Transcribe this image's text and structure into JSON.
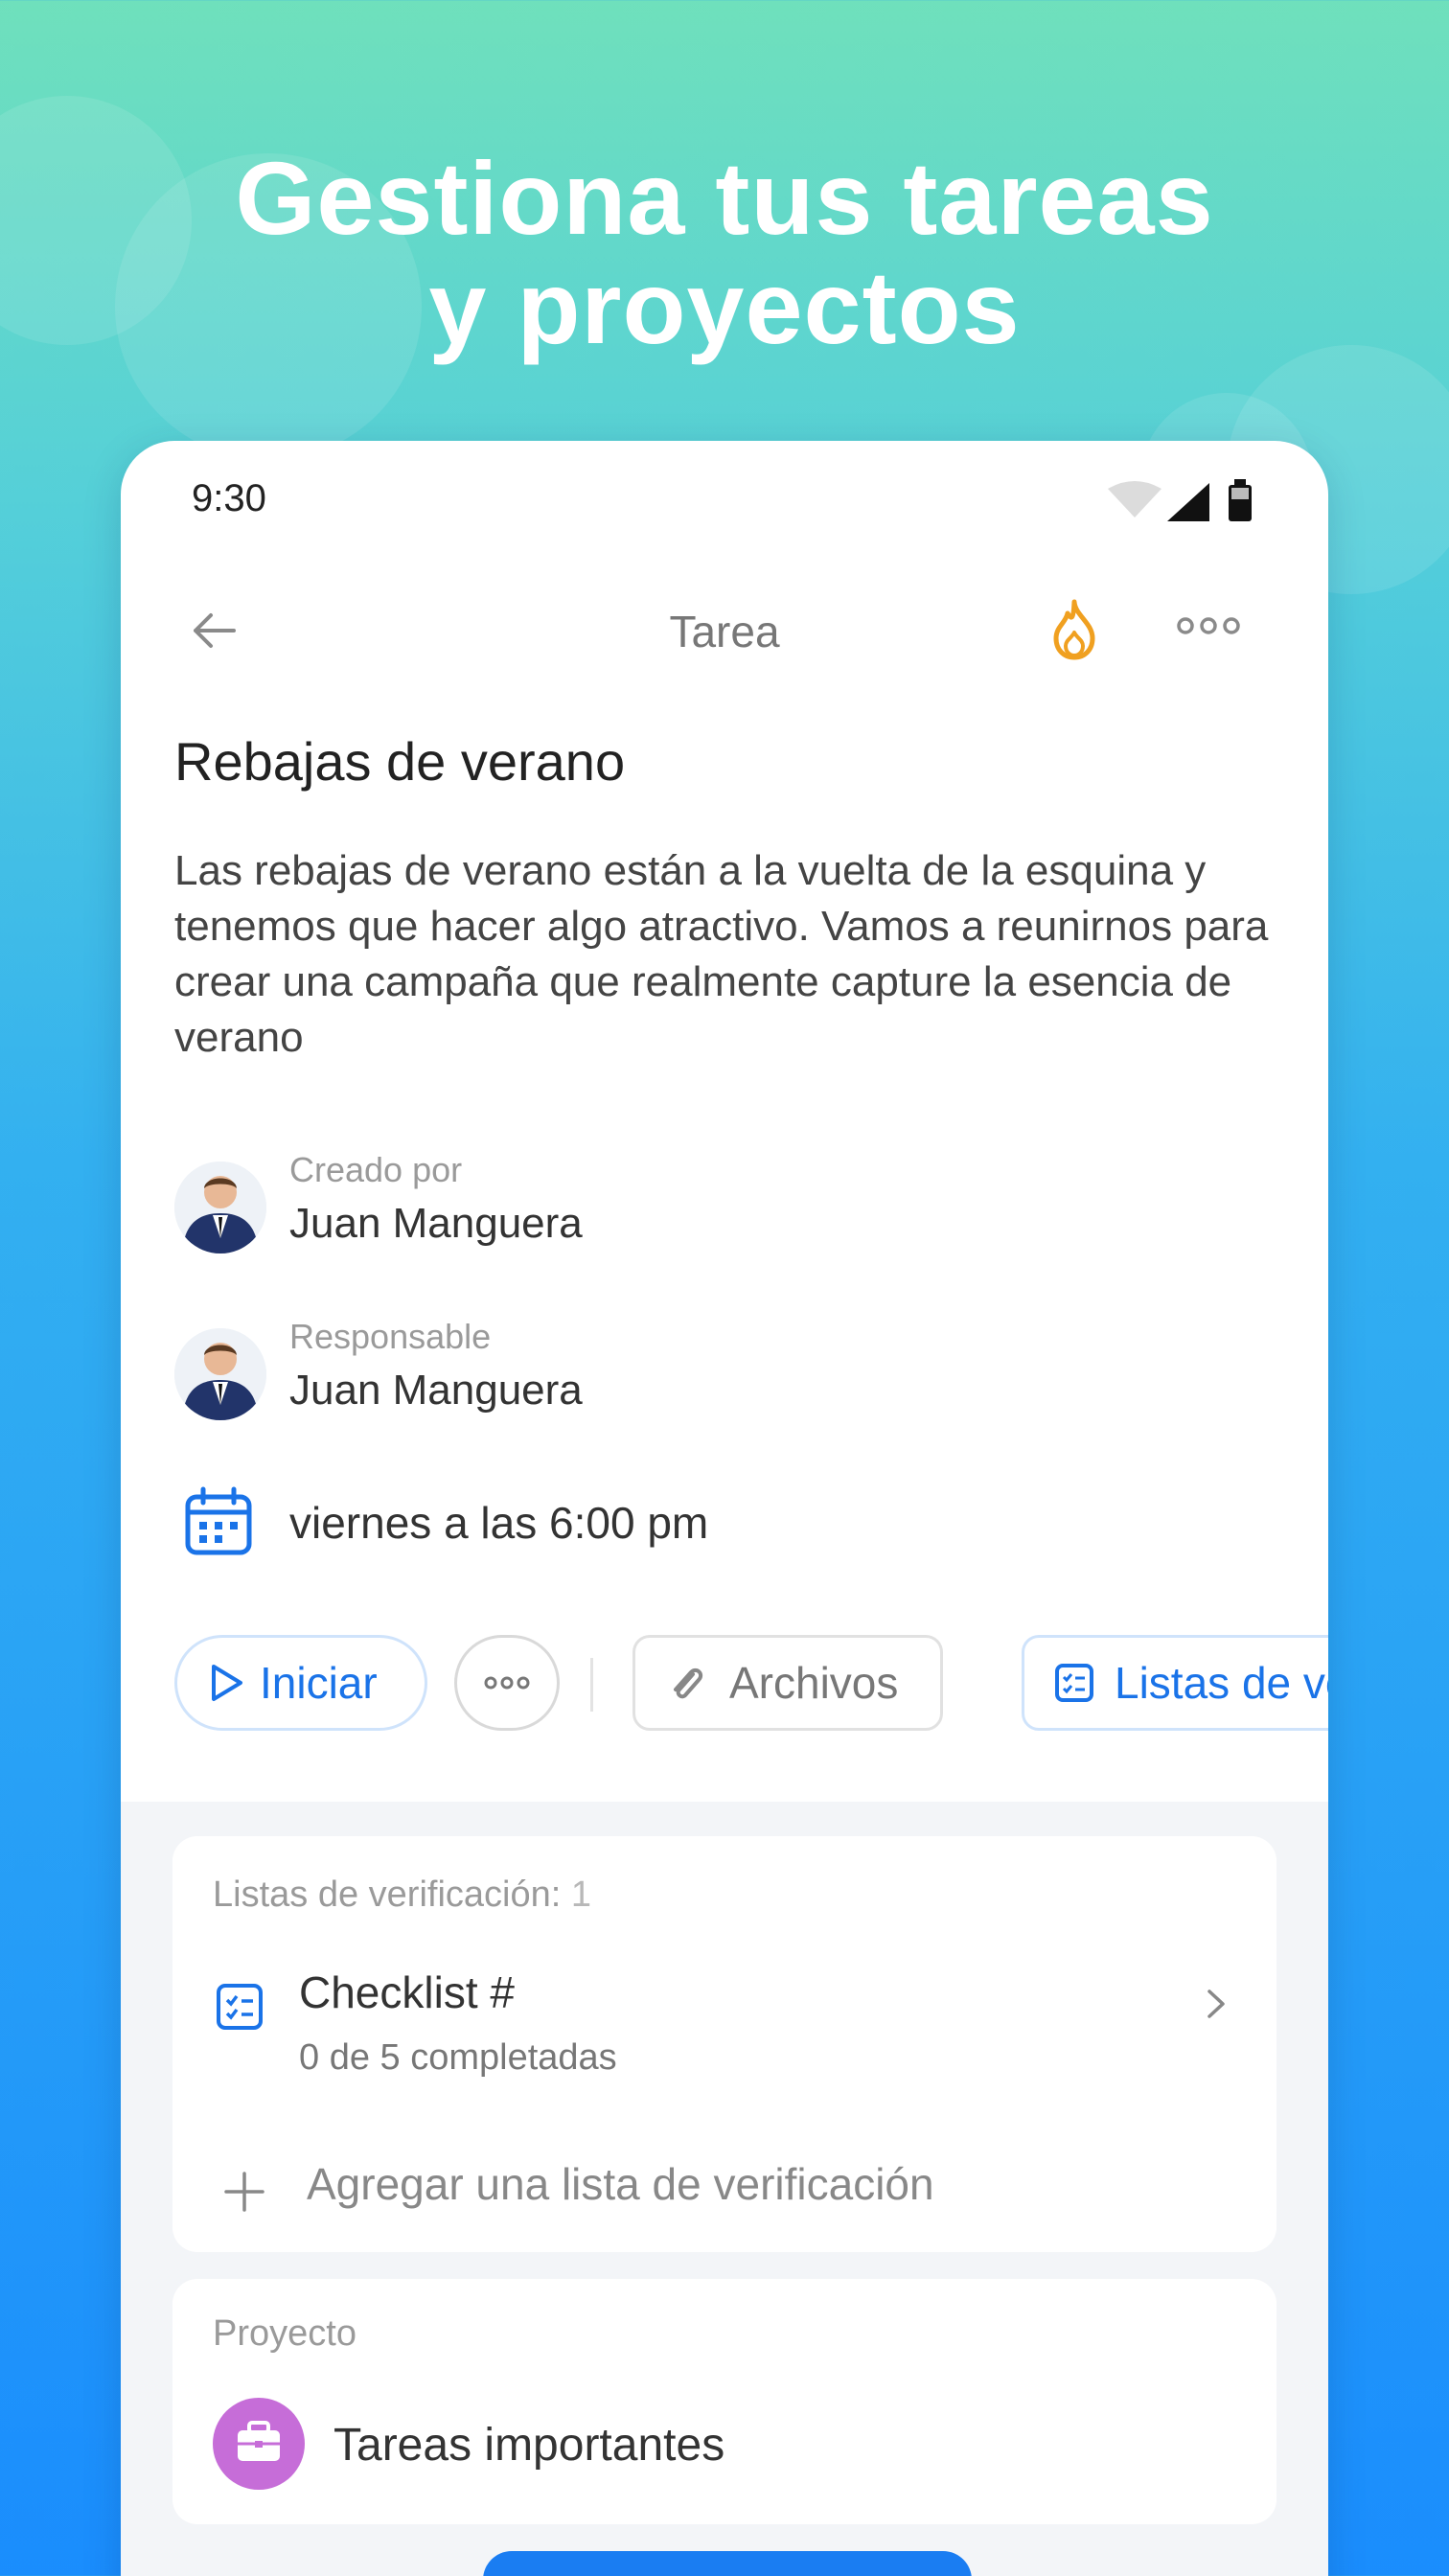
{
  "promo": {
    "headline_line1": "Gestiona tus tareas",
    "headline_line2": "y proyectos"
  },
  "status_bar": {
    "time": "9:30",
    "icons": [
      "wifi-icon",
      "signal-icon",
      "battery-icon"
    ]
  },
  "app_bar": {
    "title": "Tarea",
    "icons": [
      "back-arrow-icon",
      "fire-icon",
      "more-options-icon"
    ]
  },
  "task": {
    "title": "Rebajas de verano",
    "description": "Las rebajas de verano están a la vuelta de la esquina y tenemos que hacer algo atractivo. Vamos a reunirnos para crear una campaña que realmente capture la esencia de verano",
    "created_by": {
      "label": "Creado por",
      "name": "Juan Manguera"
    },
    "assignee": {
      "label": "Responsable",
      "name": "Juan Manguera"
    },
    "due": "viernes a las 6:00 pm"
  },
  "actions": {
    "start": "Iniciar",
    "files": "Archivos",
    "lists": "Listas de verificación"
  },
  "checklists": {
    "label": "Listas de verificación:",
    "count": "1",
    "items": [
      {
        "title": "Checklist #",
        "progress": "0 de 5 completadas"
      }
    ],
    "add_label": "Agregar una lista de verificación"
  },
  "project": {
    "label": "Proyecto",
    "name": "Tareas importantes"
  },
  "colors": {
    "accent": "#1a73e8",
    "fire": "#f0a020",
    "project_icon": "#c66dd8",
    "bg_top": "#6fe0bc",
    "bg_bottom": "#1a8dfd"
  }
}
